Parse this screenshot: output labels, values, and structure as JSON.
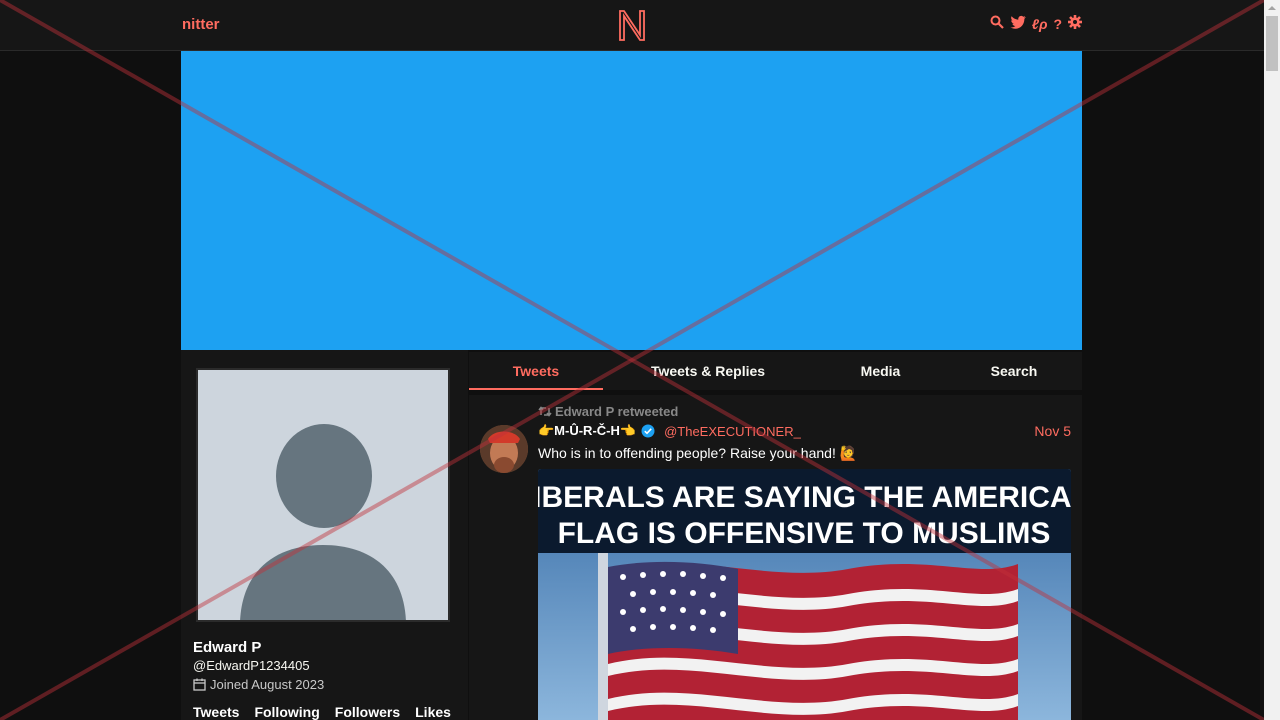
{
  "navbar": {
    "brand": "nitter",
    "logo_letter": "N",
    "icons": [
      "search-icon",
      "twitter-icon",
      "rss-icon",
      "help-icon",
      "settings-icon"
    ],
    "rss_glyph": "ℓρ",
    "help_glyph": "?"
  },
  "profile": {
    "name": "Edward P",
    "handle": "@EdwardP1234405",
    "joined": "Joined August 2023",
    "stats": [
      "Tweets",
      "Following",
      "Followers",
      "Likes"
    ]
  },
  "tabs": [
    "Tweets",
    "Tweets & Replies",
    "Media",
    "Search"
  ],
  "active_tab": "Tweets",
  "tweet": {
    "retweet_label": "Edward P retweeted",
    "fullname": "👉M-Û-R-Č-H👈",
    "username": "@TheEXECUTIONER_",
    "date": "Nov 5",
    "text": "Who is in to offending people? Raise your hand! 🙋",
    "image_caption_line1": "LIBERALS ARE SAYING THE AMERICAN",
    "image_caption_line2": "FLAG IS OFFENSIVE TO MUSLIMS"
  },
  "colors": {
    "accent": "#ff6c60",
    "banner": "#1da1f2",
    "background": "#0f0f0f",
    "panel": "#161616",
    "verified": "#1da1f2"
  }
}
